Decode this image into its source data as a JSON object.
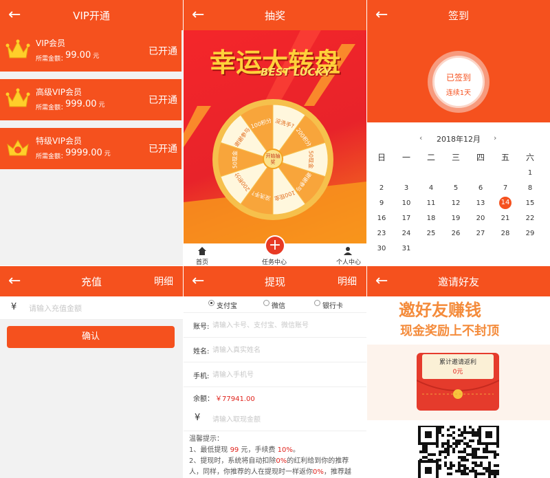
{
  "vip": {
    "title": "VIP开通",
    "tiers": [
      {
        "name": "VIP会员",
        "fee_label": "所需金额：",
        "fee": "99.00",
        "unit": "元",
        "status": "已开通"
      },
      {
        "name": "高级VIP会员",
        "fee_label": "所需金额：",
        "fee": "999.00",
        "unit": "元",
        "status": "已开通"
      },
      {
        "name": "特级VIP会员",
        "fee_label": "所需金额：",
        "fee": "9999.00",
        "unit": "元",
        "status": "已开通"
      }
    ]
  },
  "lottery": {
    "title": "抽奖",
    "banner_cn": "幸运大转盘",
    "banner_en": "BEST LUCKY",
    "segments": [
      "没洗手?",
      "200积分",
      "50现金",
      "谢谢参与",
      "100现金",
      "没洗手?",
      "200积分",
      "50现金",
      "谢谢参与",
      "100积分"
    ],
    "center": "开始抽奖",
    "tabs": [
      "首页",
      "任务中心",
      "个人中心"
    ]
  },
  "signin": {
    "title": "签到",
    "status": "已签到",
    "streak": "连续1天",
    "month": "2018年12月",
    "prev": "‹",
    "next": "›",
    "weekdays": [
      "日",
      "一",
      "二",
      "三",
      "四",
      "五",
      "六"
    ],
    "days": [
      "",
      "",
      "",
      "",
      "",
      "",
      "1",
      "2",
      "3",
      "4",
      "5",
      "6",
      "7",
      "8",
      "9",
      "10",
      "11",
      "12",
      "13",
      "14",
      "15",
      "16",
      "17",
      "18",
      "19",
      "20",
      "21",
      "22",
      "23",
      "24",
      "25",
      "26",
      "27",
      "28",
      "29",
      "30",
      "31"
    ],
    "today": "14"
  },
  "recharge": {
    "title": "充值",
    "detail": "明细",
    "currency": "¥",
    "placeholder": "请输入充值金额",
    "confirm": "确认"
  },
  "withdraw": {
    "title": "提现",
    "detail": "明细",
    "methods": [
      "支付宝",
      "微信",
      "银行卡"
    ],
    "account_label": "账号:",
    "account_ph": "请输入卡号、支付宝、微信账号",
    "name_label": "姓名:",
    "name_ph": "请输入真实姓名",
    "phone_label": "手机:",
    "phone_ph": "请输入手机号",
    "balance_label": "余额：",
    "balance": "￥77941.00",
    "currency": "¥",
    "amount_ph": "请输入取现金额",
    "tips_title": "温馨提示：",
    "tip1_a": "1、最低提现",
    "tip1_amt": "99",
    "tip1_b": "元，手续费",
    "tip1_fee": "10%",
    "tip2_a": "2、提现时，系统将自动扣除",
    "tip2_pct": "0%",
    "tip2_b": "的红利给到你的推荐",
    "tip3_a": "人，同样，你推荐的人在提现时一样返你",
    "tip3_pct": "0%",
    "tip3_b": "，推荐越"
  },
  "invite": {
    "title": "邀请好友",
    "headline1": "邀好友赚钱",
    "headline2": "现金奖励上不封顶",
    "reward_label": "累计邀请返利",
    "reward_value": "0元"
  },
  "colors": {
    "brand": "#f5511e",
    "highlight": "#e0231c",
    "gold": "#ffd13a"
  },
  "icons": {
    "back": "←",
    "home": "home-icon",
    "plus": "plus-icon",
    "user": "user-icon",
    "crown": "crown-icon"
  }
}
